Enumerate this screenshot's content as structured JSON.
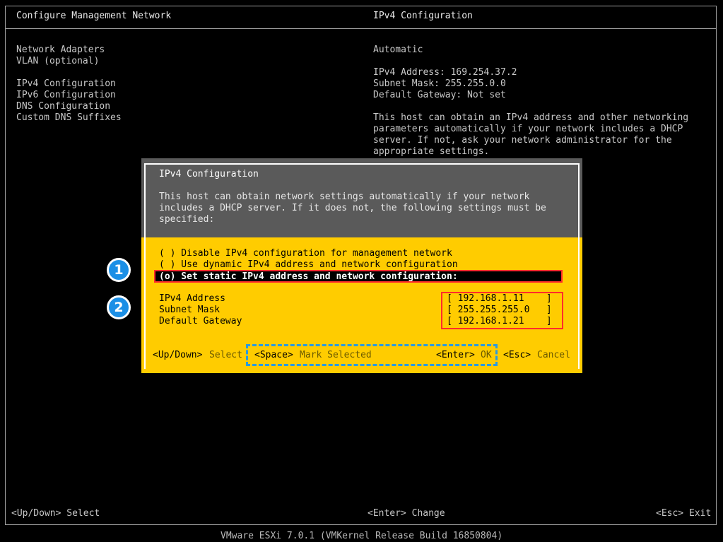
{
  "left_panel": {
    "title": "Configure Management Network",
    "menu": [
      "Network Adapters",
      "VLAN (optional)",
      "IPv4 Configuration",
      "IPv6 Configuration",
      "DNS Configuration",
      "Custom DNS Suffixes"
    ]
  },
  "right_panel": {
    "title": "IPv4 Configuration",
    "mode": "Automatic",
    "ipv4_address_line": "IPv4 Address: 169.254.37.2",
    "subnet_mask_line": "Subnet Mask: 255.255.0.0",
    "gateway_line": "Default Gateway: Not set",
    "description": [
      "This host can obtain an IPv4 address and other networking",
      "parameters automatically if your network includes a DHCP",
      "server. If not, ask your network administrator for the",
      "appropriate settings."
    ]
  },
  "dialog": {
    "title": "IPv4 Configuration",
    "description": [
      "This host can obtain network settings automatically if your network",
      "includes a DHCP server. If it does not, the following settings must be",
      "specified:"
    ],
    "options": [
      "( ) Disable IPv4 configuration for management network",
      "( ) Use dynamic IPv4 address and network configuration",
      "(o) Set static IPv4 address and network configuration:"
    ],
    "fields": [
      {
        "label": "IPv4 Address",
        "value": "[ 192.168.1.11    ]"
      },
      {
        "label": "Subnet Mask",
        "value": "[ 255.255.255.0   ]"
      },
      {
        "label": "Default Gateway",
        "value": "[ 192.168.1.21    ]"
      }
    ],
    "hints": {
      "updown_key": "<Up/Down>",
      "updown_action": "Select",
      "space_key": "<Space>",
      "space_action": "Mark Selected",
      "enter_key": "<Enter>",
      "enter_action": "OK",
      "esc_key": "<Esc>",
      "esc_action": "Cancel"
    }
  },
  "callouts": [
    "1",
    "2"
  ],
  "footer": {
    "updown": "<Up/Down> Select",
    "enter": "<Enter> Change",
    "esc": "<Esc> Exit",
    "version": "VMware ESXi 7.0.1 (VMKernel Release Build 16850804)"
  },
  "colors": {
    "dialog_bg": "#ffcc00",
    "dialog_header_bg": "#5a5a5a",
    "highlight_border": "#ff2b2b",
    "callout_bg": "#1b8fe6",
    "dashed_border": "#2a9ae0"
  }
}
